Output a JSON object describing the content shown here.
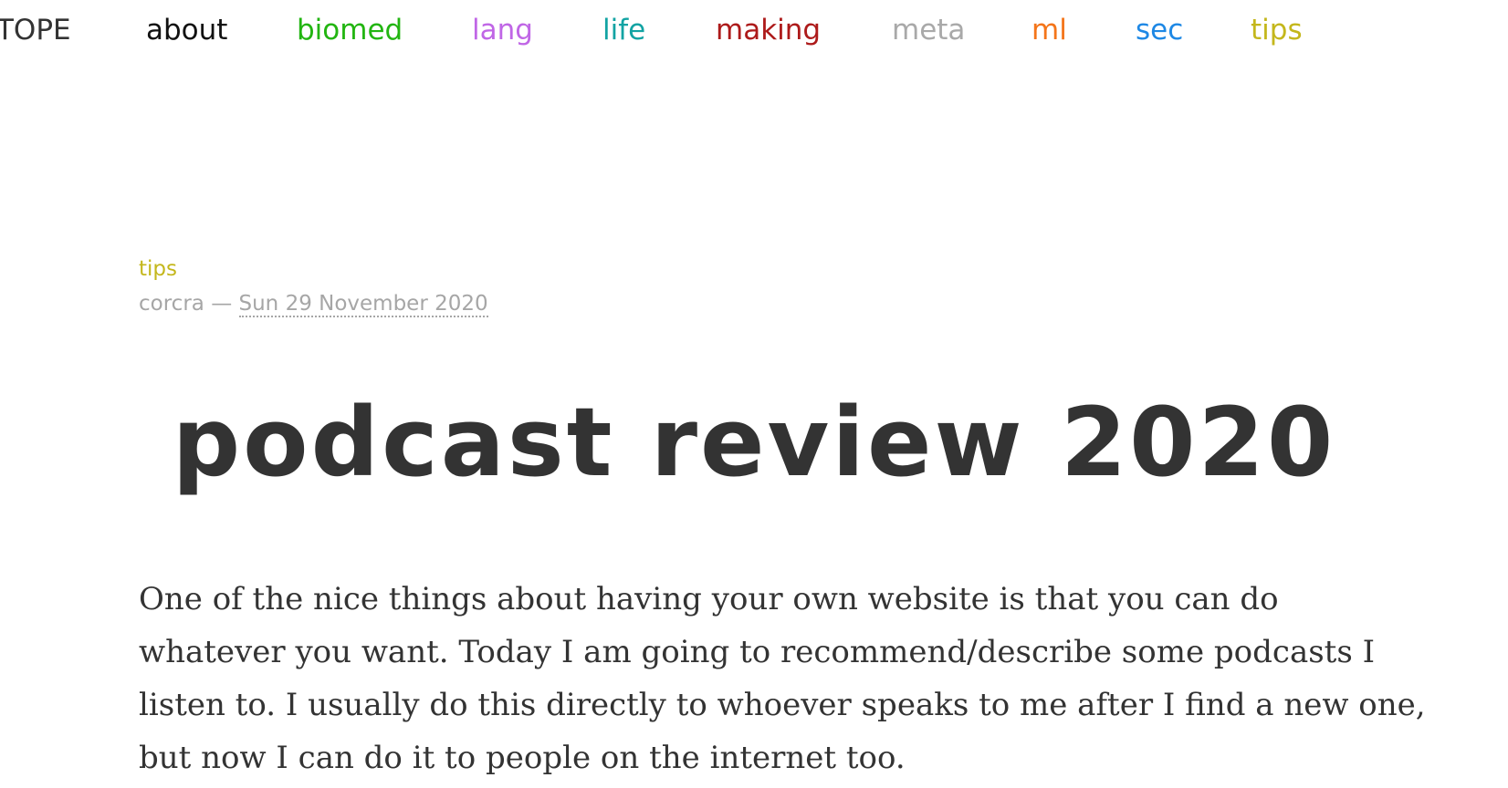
{
  "nav": {
    "brand": "TOPE",
    "links": [
      {
        "label": "about",
        "color": "#111111"
      },
      {
        "label": "biomed",
        "color": "#22b511"
      },
      {
        "label": "lang",
        "color": "#c066e6"
      },
      {
        "label": "life",
        "color": "#12a3a3"
      },
      {
        "label": "making",
        "color": "#ad1a1a"
      },
      {
        "label": "meta",
        "color": "#a9a9a9"
      },
      {
        "label": "ml",
        "color": "#f4751a"
      },
      {
        "label": "sec",
        "color": "#1e88e5"
      },
      {
        "label": "tips",
        "color": "#c4b71c"
      }
    ]
  },
  "post": {
    "category": "tips",
    "author": "corcra",
    "separator": "—",
    "date": "Sun 29 November 2020",
    "title": "podcast review 2020",
    "body": "One of the nice things about having your own website is that you can do whatever you want. Today I am going to recommend/describe some podcasts I listen to. I usually do this directly to whoever speaks to me after I find a new one, but now I can do it to people on the internet too."
  }
}
